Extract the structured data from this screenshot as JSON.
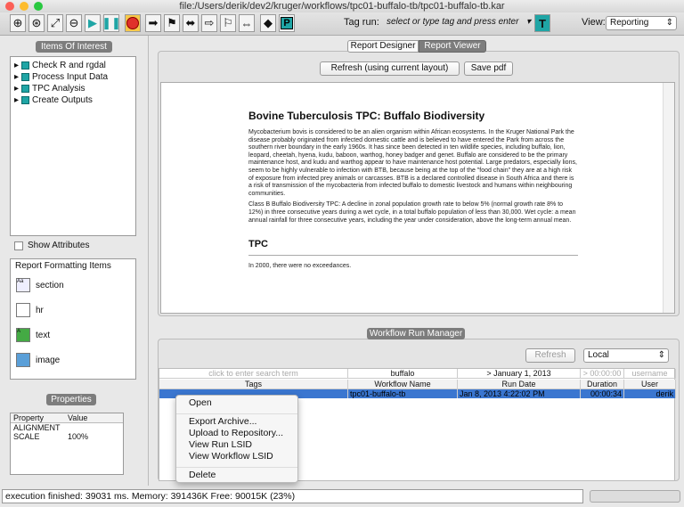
{
  "window": {
    "title": "file:/Users/derik/dev2/kruger/workflows/tpc01-buffalo-tb/tpc01-buffalo-tb.kar"
  },
  "toolbar": {
    "icons": [
      "zoom-in-icon",
      "zoom-reset-icon",
      "zoom-fit-icon",
      "zoom-out-icon",
      "run-icon",
      "pause-icon",
      "stop-icon",
      "arrow-icon",
      "flag-icon",
      "arrow-both-icon",
      "arrow-outline-icon",
      "flag-outline-icon",
      "arrow-both-outline-icon",
      "diamond-icon",
      "port-icon"
    ],
    "tag_run_label": "Tag run:",
    "tag_run_placeholder": "select or type tag and press enter",
    "tag_button": "T",
    "view_label": "View:",
    "view_value": "Reporting"
  },
  "left": {
    "items_header": "Items Of Interest",
    "tree": [
      "Check R and rgdal",
      "Process Input Data",
      "TPC Analysis",
      "Create Outputs"
    ],
    "show_attributes": "Show Attributes",
    "formatting_title": "Report Formatting Items",
    "formatting_items": [
      "section",
      "hr",
      "text",
      "image"
    ],
    "properties_header": "Properties",
    "properties_columns": [
      "Property",
      "Value"
    ],
    "properties_rows": [
      [
        "ALIGNMENT",
        ""
      ],
      [
        "SCALE",
        "100%"
      ]
    ]
  },
  "report": {
    "tabs": [
      "Report Designer",
      "Report Viewer"
    ],
    "active_tab": "Report Viewer",
    "refresh_button": "Refresh (using current layout)",
    "save_pdf_button": "Save pdf",
    "doc_title": "Bovine Tuberculosis TPC: Buffalo Biodiversity",
    "para1": "Mycobacterium bovis is considered to be an alien organism within African ecosystems. In the Kruger National Park the disease probably originated from infected domestic cattle and is believed to have entered the Park from across the southern river boundary in the early 1960s. It has since been detected in ten wildlife species, including buffalo, lion, leopard, cheetah, hyena, kudu, baboon, warthog, honey badger and genet. Buffalo are considered to be the primary maintenance host, and kudu and warthog appear to have maintenance host potential. Large predators, especially lions, seem to be highly vulnerable to infection with BTB, because being at the top of the \"food chain\" they are at a high risk of exposure from infected prey animals or carcasses. BTB is a declared controlled disease in South Africa and there is a risk of transmission of the mycobacteria from infected buffalo to domestic livestock and humans within neighbouring communities.",
    "para2": "Class B Buffalo Biodiversity TPC: A decline in zonal population growth rate to below 5% (normal growth rate 8% to 12%) in three consecutive years during a wet cycle, in a total buffalo population of less than 30,000. Wet cycle: a mean annual rainfall for three consecutive years, including the year under consideration, above the long-term annual mean.",
    "section2_title": "TPC",
    "section2_text": "In 2000, there were no exceedances."
  },
  "run_manager": {
    "header": "Workflow Run Manager",
    "refresh_button": "Refresh",
    "location_value": "Local",
    "filters": {
      "tags": "click to enter search term",
      "workflow": "buffalo",
      "date": "> January 1, 2013",
      "duration": "> 00:00:00",
      "user": "username"
    },
    "columns": [
      "Tags",
      "Workflow Name",
      "Run Date",
      "Duration",
      "User"
    ],
    "rows": [
      {
        "tags": "",
        "workflow": "tpc01-buffalo-tb",
        "date": "Jan 8, 2013 4:22:02 PM",
        "duration": "00:00:34",
        "user": "derik",
        "selected": true
      }
    ]
  },
  "context_menu": [
    "Open",
    "Export Archive...",
    "Upload to Repository...",
    "View Run LSID",
    "View Workflow LSID",
    "Delete"
  ],
  "status": {
    "text": "execution finished: 39031 ms. Memory: 391436K Free: 90015K (23%)"
  },
  "colors": {
    "selection": "#3a76d0",
    "accent": "#1fa5a5",
    "stop": "#e0302a"
  }
}
